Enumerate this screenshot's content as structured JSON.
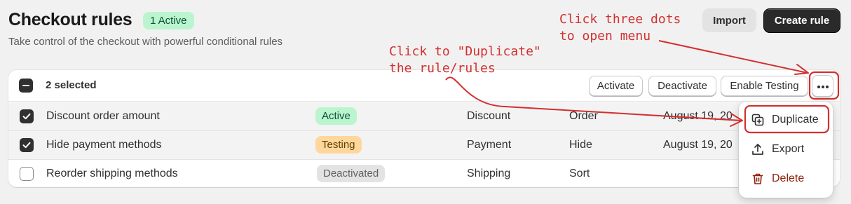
{
  "header": {
    "title": "Checkout rules",
    "active_badge": "1 Active",
    "subtitle": "Take control of the checkout with powerful conditional rules",
    "import_label": "Import",
    "create_label": "Create rule"
  },
  "bulk_bar": {
    "selected_text": "2 selected",
    "activate_label": "Activate",
    "deactivate_label": "Deactivate",
    "enable_testing_label": "Enable Testing",
    "more_icon": "more-horizontal-icon"
  },
  "rules": [
    {
      "name": "Discount order amount",
      "status": "Active",
      "type": "Discount",
      "action": "Order",
      "date": "August 19, 20",
      "checked": true
    },
    {
      "name": "Hide payment methods",
      "status": "Testing",
      "type": "Payment",
      "action": "Hide",
      "date": "August 19, 20",
      "checked": true
    },
    {
      "name": "Reorder shipping methods",
      "status": "Deactivated",
      "type": "Shipping",
      "action": "Sort",
      "date": "",
      "checked": false
    }
  ],
  "menu": {
    "duplicate_label": "Duplicate",
    "export_label": "Export",
    "delete_label": "Delete"
  },
  "annotations": {
    "three_dots_line1": "Click three dots",
    "three_dots_line2": "to open menu",
    "duplicate_line1": "Click to \"Duplicate\"",
    "duplicate_line2": "the rule/rules"
  },
  "colors": {
    "active_bg": "#bbf5cf",
    "testing_bg": "#ffd79d",
    "deactivated_bg": "#e3e3e3",
    "annotation": "#d32f2f",
    "delete": "#8e1f0b"
  }
}
